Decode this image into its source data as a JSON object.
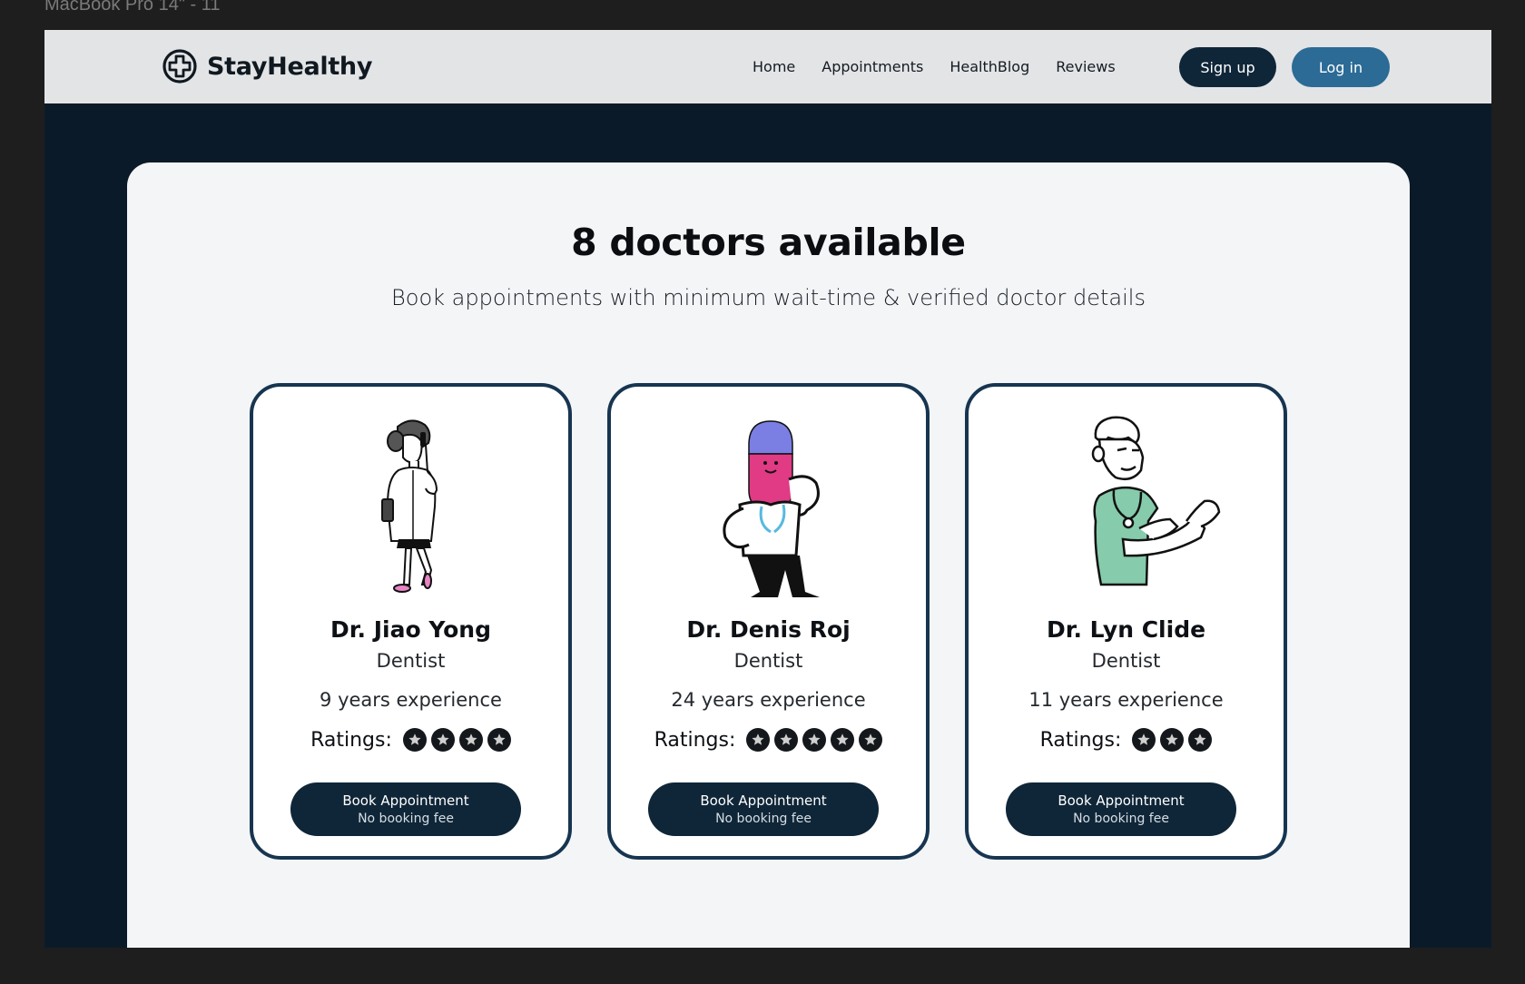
{
  "frame": {
    "label": "MacBook Pro 14\" - 11"
  },
  "navbar": {
    "brand": {
      "name": "StayHealthy",
      "icon": "medical-cross-icon"
    },
    "links": [
      {
        "label": "Home"
      },
      {
        "label": "Appointments"
      },
      {
        "label": "HealthBlog"
      },
      {
        "label": "Reviews"
      }
    ],
    "signup_label": "Sign up",
    "login_label": "Log in"
  },
  "main": {
    "headline": "8 doctors available",
    "subheadline": "Book appointments with minimum wait-time & verified doctor details",
    "ratings_label": "Ratings:",
    "doctors": [
      {
        "name": "Dr. Jiao Yong",
        "specialty": "Dentist",
        "experience": "9 years experience",
        "rating": 4,
        "illustration": "female-doctor-phone-illustration",
        "book_label": "Book Appointment",
        "fee_label": "No booking fee"
      },
      {
        "name": "Dr. Denis Roj",
        "specialty": "Dentist",
        "experience": "24 years experience",
        "rating": 5,
        "illustration": "pill-character-doctor-illustration",
        "book_label": "Book Appointment",
        "fee_label": "No booking fee"
      },
      {
        "name": "Dr. Lyn Clide",
        "specialty": "Dentist",
        "experience": "11 years experience",
        "rating": 3,
        "illustration": "male-doctor-scrubs-illustration",
        "book_label": "Book Appointment",
        "fee_label": "No booking fee"
      }
    ]
  },
  "colors": {
    "dark_navy": "#0f2638",
    "login_blue": "#2b6b96",
    "card_border": "#173550",
    "background": "#0a1a29"
  }
}
